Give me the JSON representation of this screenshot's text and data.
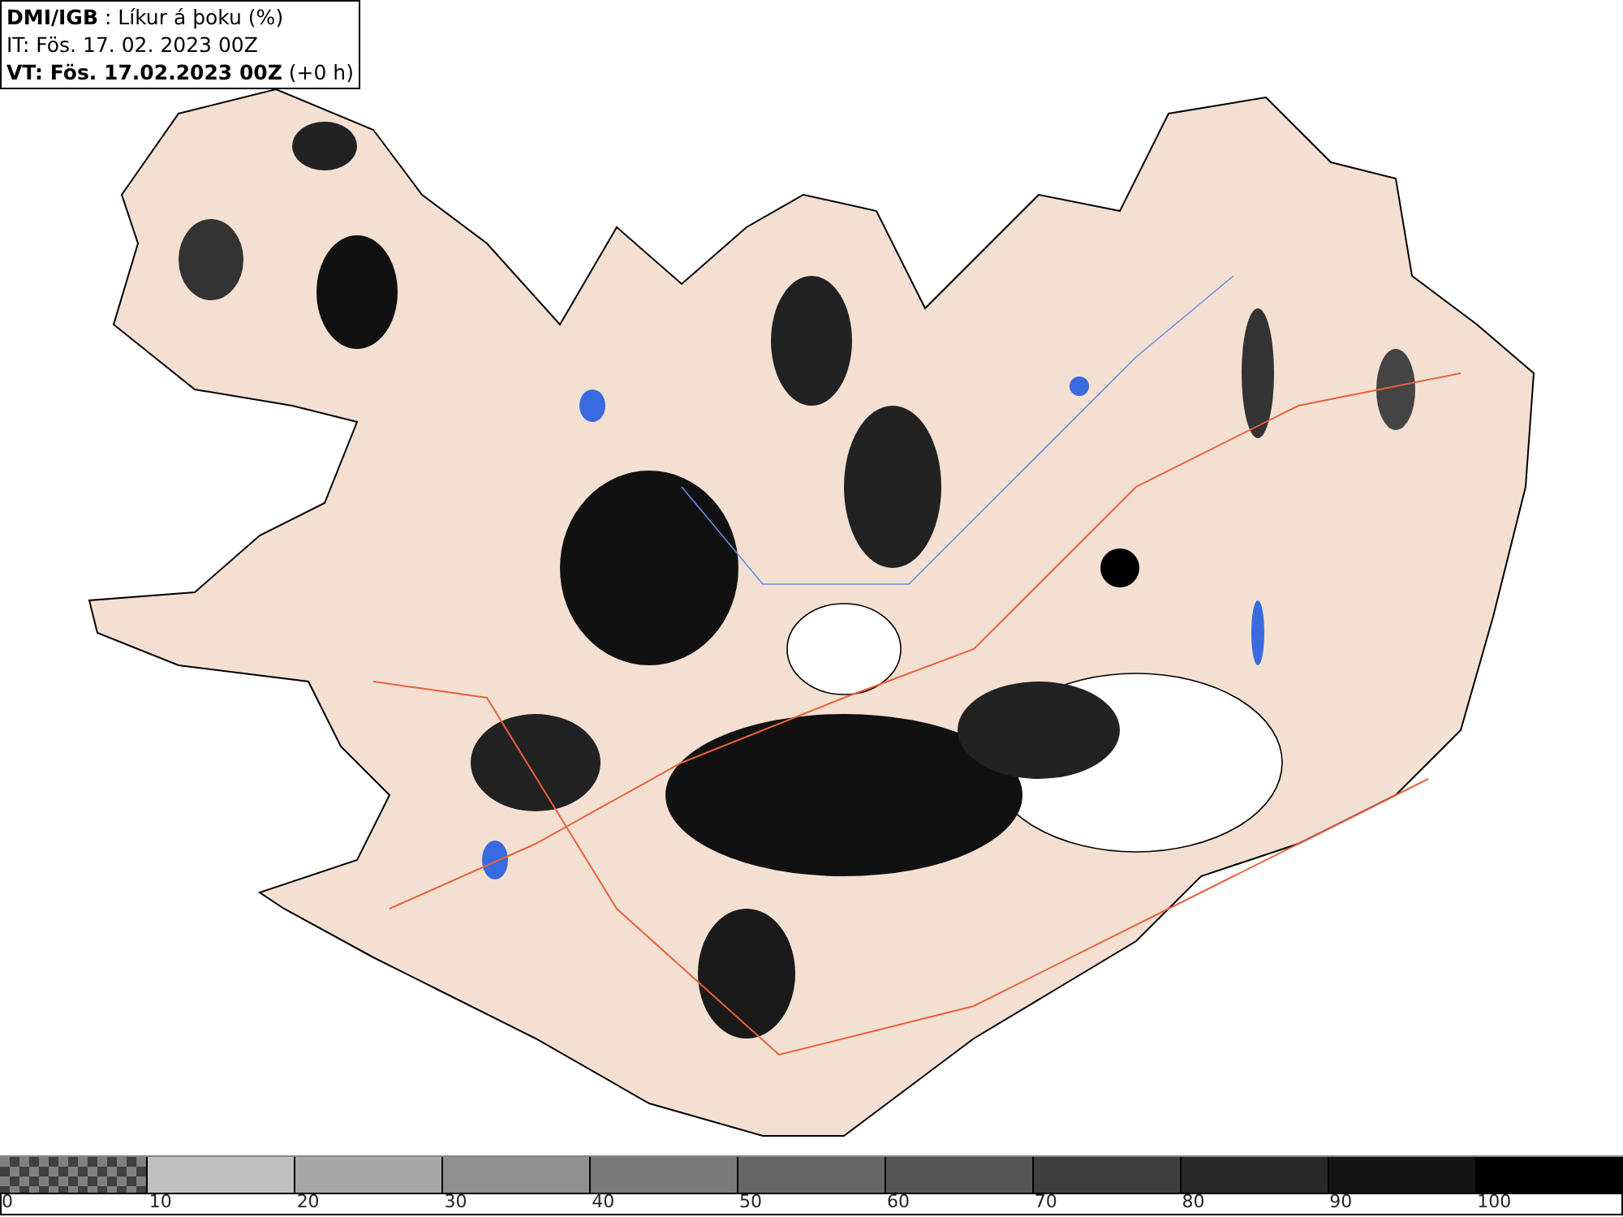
{
  "header": {
    "title": "**DMI/IGB** : Líkur á þoku (%)",
    "issued": "IT: Fös. 17. 02. 2023 00Z",
    "valid": "**VT: Fös. 17.02.2023 00Z** (+0 h)"
  },
  "legend": {
    "segments": [
      {
        "kind": "checker",
        "color": "#404040"
      },
      {
        "kind": "solid",
        "color": "#c0c0c0"
      },
      {
        "kind": "solid",
        "color": "#a8a8a8"
      },
      {
        "kind": "solid",
        "color": "#909090"
      },
      {
        "kind": "solid",
        "color": "#7a7a7a"
      },
      {
        "kind": "solid",
        "color": "#666666"
      },
      {
        "kind": "solid",
        "color": "#555555"
      },
      {
        "kind": "solid",
        "color": "#3e3e3e"
      },
      {
        "kind": "solid",
        "color": "#282828"
      },
      {
        "kind": "solid",
        "color": "#141414"
      },
      {
        "kind": "solid",
        "color": "#000000"
      }
    ],
    "ticks": [
      "0",
      "10",
      "20",
      "30",
      "40",
      "50",
      "60",
      "70",
      "80",
      "90",
      "100"
    ]
  }
}
